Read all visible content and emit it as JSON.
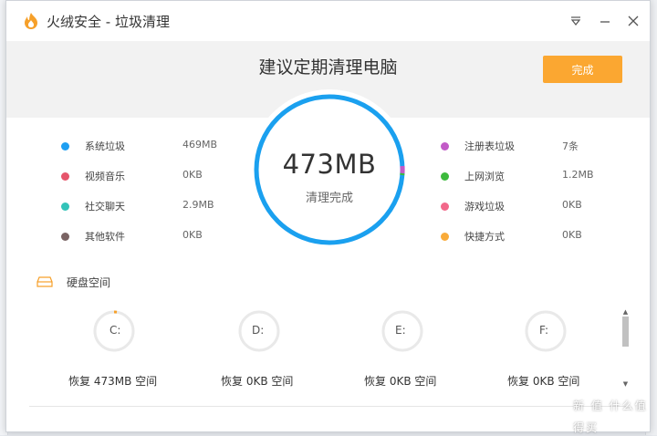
{
  "window": {
    "title": "火绒安全 - 垃圾清理",
    "menu_icon": "dropdown-menu-icon",
    "min_icon": "minimize-icon",
    "close_icon": "close-icon"
  },
  "header": {
    "headline": "建议定期清理电脑",
    "done_label": "完成",
    "accent": "#fba731"
  },
  "summary": {
    "total": "473MB",
    "status": "清理完成",
    "ring_color": "#1aa0ef"
  },
  "categories_left": [
    {
      "name": "系统垃圾",
      "size": "469MB",
      "color": "#1e9ff2"
    },
    {
      "name": "视频音乐",
      "size": "0KB",
      "color": "#e6556b"
    },
    {
      "name": "社交聊天",
      "size": "2.9MB",
      "color": "#33c3b9"
    },
    {
      "name": "其他软件",
      "size": "0KB",
      "color": "#7a6464"
    }
  ],
  "categories_right": [
    {
      "name": "注册表垃圾",
      "size": "7条",
      "color": "#c25bc7"
    },
    {
      "name": "上网浏览",
      "size": "1.2MB",
      "color": "#3dba3d"
    },
    {
      "name": "游戏垃圾",
      "size": "0KB",
      "color": "#f2688a"
    },
    {
      "name": "快捷方式",
      "size": "0KB",
      "color": "#f9ab3a"
    }
  ],
  "disk": {
    "title": "硬盘空间",
    "icon": "hard-disk-icon",
    "drives": [
      {
        "letter": "C:",
        "recovered": "恢复 473MB 空间",
        "fraction": 0.02
      },
      {
        "letter": "D:",
        "recovered": "恢复 0KB 空间",
        "fraction": 0
      },
      {
        "letter": "E:",
        "recovered": "恢复 0KB 空间",
        "fraction": 0
      },
      {
        "letter": "F:",
        "recovered": "恢复 0KB 空间",
        "fraction": 0
      }
    ]
  },
  "watermark": "新 值 什么值得买"
}
